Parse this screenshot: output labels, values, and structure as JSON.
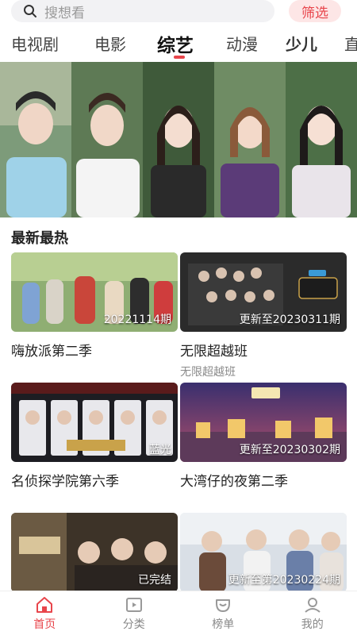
{
  "search": {
    "placeholder": "搜想看"
  },
  "filter_label": "筛选",
  "tabs": [
    {
      "label": "电视剧"
    },
    {
      "label": "电影"
    },
    {
      "label": "综艺",
      "active": true
    },
    {
      "label": "动漫"
    },
    {
      "label": "少儿"
    },
    {
      "label": "直"
    }
  ],
  "section_title": "最新最热",
  "cards": [
    {
      "title": "嗨放派第二季",
      "badge": "20221114期",
      "subtitle": ""
    },
    {
      "title": "无限超越班",
      "badge": "更新至20230311期",
      "subtitle": "无限超越班"
    },
    {
      "title": "名侦探学院第六季",
      "badge": "蓝光",
      "subtitle": ""
    },
    {
      "title": "大湾仔的夜第二季",
      "badge": "更新至20230302期",
      "subtitle": ""
    },
    {
      "title": "",
      "badge": "已完结",
      "subtitle": ""
    },
    {
      "title": "",
      "badge": "更新至第20230224期",
      "subtitle": ""
    }
  ],
  "nav": [
    {
      "label": "首页",
      "icon": "home-icon",
      "active": true
    },
    {
      "label": "分类",
      "icon": "category-icon"
    },
    {
      "label": "榜单",
      "icon": "ranking-icon"
    },
    {
      "label": "我的",
      "icon": "profile-icon"
    }
  ],
  "colors": {
    "accent": "#e8454b",
    "accent_light": "#fde6e6",
    "search_bg": "#f2f2f4"
  }
}
